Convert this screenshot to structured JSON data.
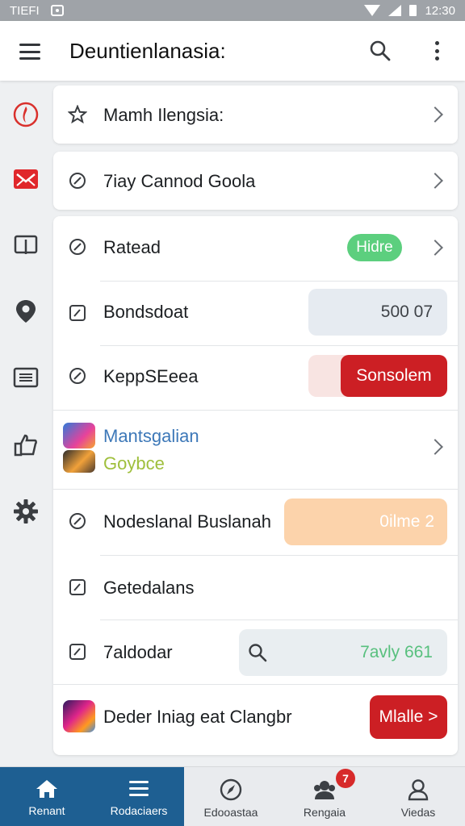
{
  "status_bar": {
    "carrier": "TIEFI",
    "time": "12:30"
  },
  "app_bar": {
    "title": "Deuntienlanasia:"
  },
  "rail": {
    "icons": [
      "flame-icon",
      "mail-icon",
      "book-icon",
      "location-pin-icon",
      "list-card-icon",
      "thumb-up-icon",
      "gear-icon"
    ]
  },
  "cards": {
    "first": {
      "label": "Mamh Ilengsia:"
    },
    "second": {
      "label": "7iay Cannod Goola"
    },
    "rows": {
      "ratead": {
        "label": "Ratead",
        "pill": "Hidre"
      },
      "bondsdoat": {
        "label": "Bondsdoat",
        "value": "500 07"
      },
      "keppseeea": {
        "label": "KeppSEeea",
        "button": "Sonsolem"
      },
      "mantsgalian": {
        "title": "Mantsgalian",
        "subtitle": "Goybce"
      },
      "nodeslanal": {
        "label": "Nodeslanal Buslanah",
        "pill": "0ilme 2"
      },
      "getedalans": {
        "label": "Getedalans"
      },
      "zadodar": {
        "label": "7aldodar",
        "search_value": "7avly 661"
      },
      "deder": {
        "label": "Deder Iniag eat Clangbr",
        "button": "Mlalle >"
      }
    }
  },
  "colors": {
    "accent": "#1e5f92",
    "green": "#5ccf7e",
    "red": "#cc1f24",
    "orange": "#fcd3ab"
  },
  "bottom_nav": {
    "items": [
      {
        "label": "Renant",
        "icon": "home-icon"
      },
      {
        "label": "Rodaciaers",
        "icon": "list-icon"
      },
      {
        "label": "Edooastaa",
        "icon": "compass-icon"
      },
      {
        "label": "Rengaia",
        "icon": "people-icon",
        "badge": "7"
      },
      {
        "label": "Viedas",
        "icon": "profile-icon"
      }
    ]
  }
}
